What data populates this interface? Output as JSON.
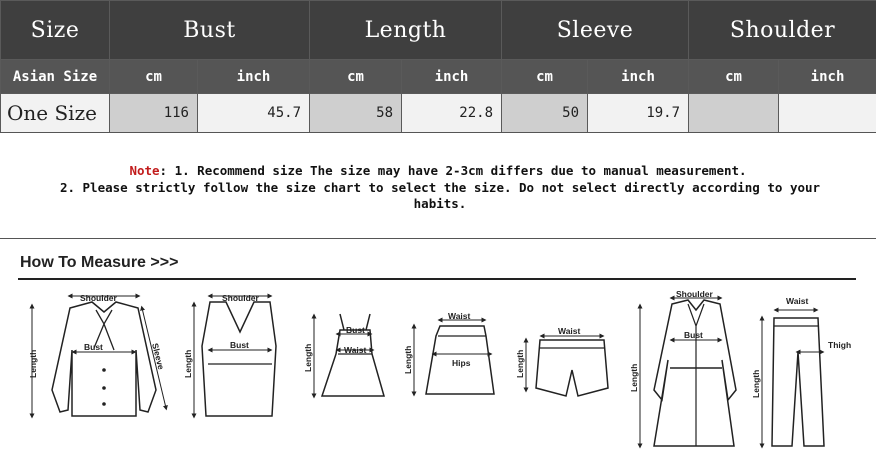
{
  "size_table": {
    "headers": [
      "Size",
      "Bust",
      "Length",
      "Sleeve",
      "Shoulder"
    ],
    "unit_row_label": "Asian Size",
    "units": [
      "cm",
      "inch",
      "cm",
      "inch",
      "cm",
      "inch",
      "cm",
      "inch"
    ],
    "row_label": "One Size",
    "values": [
      "116",
      "45.7",
      "58",
      "22.8",
      "50",
      "19.7",
      "",
      ""
    ]
  },
  "note": {
    "prefix": "Note",
    "line1": ": 1. Recommend size  The size may have 2-3cm differs due to manual measurement.",
    "line2": "2. Please strictly follow the size chart to select the size. Do not select directly according to your habits."
  },
  "measure": {
    "title": "How To Measure >>>",
    "labels": {
      "shoulder": "Shoulder",
      "bust": "Bust",
      "length": "Length",
      "sleeve": "Sleeve",
      "waist": "Waist",
      "hips": "Hips",
      "thigh": "Thigh"
    }
  }
}
